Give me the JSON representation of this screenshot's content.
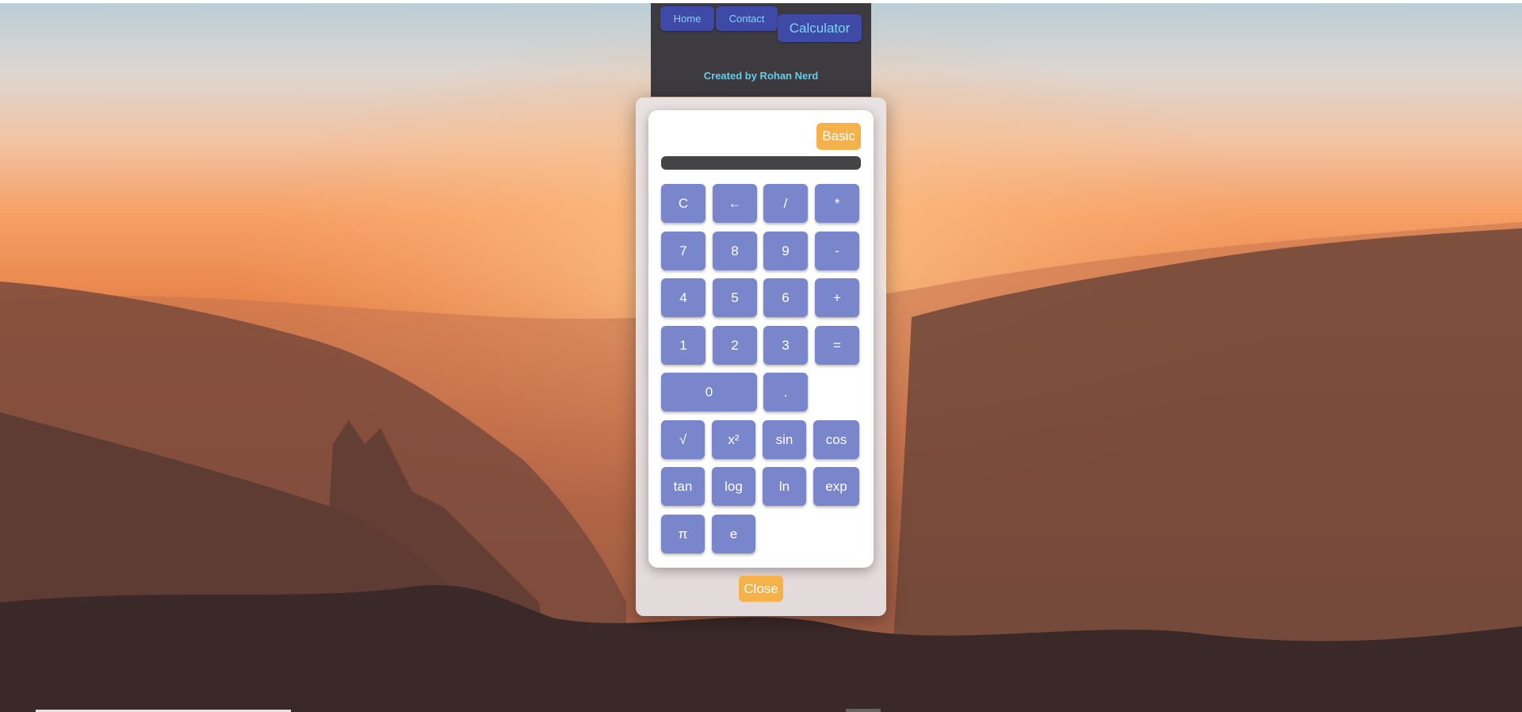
{
  "nav": {
    "home_label": "Home",
    "contact_label": "Contact",
    "calculator_label": "Calculator",
    "credit_text": "Created by Rohan Nerd"
  },
  "calculator": {
    "mode_label": "Basic",
    "display_value": "",
    "keys": {
      "clear": "C",
      "backspace": "←",
      "divide": "/",
      "multiply": "*",
      "seven": "7",
      "eight": "8",
      "nine": "9",
      "minus": "-",
      "four": "4",
      "five": "5",
      "six": "6",
      "plus": "+",
      "one": "1",
      "two": "2",
      "three": "3",
      "equals": "=",
      "zero": "0",
      "decimal": ".",
      "sqrt": "√",
      "square": "x²",
      "sin": "sin",
      "cos": "cos",
      "tan": "tan",
      "log": "log",
      "ln": "ln",
      "exp": "exp",
      "pi": "π",
      "e": "e"
    },
    "close_label": "Close"
  },
  "colors": {
    "nav_button": "#3e4aa6",
    "nav_text": "#7fd3f7",
    "credit_text": "#62cde8",
    "accent_orange": "#f5b14a",
    "key_blue": "#7a86cc",
    "display_dark": "#444446"
  }
}
